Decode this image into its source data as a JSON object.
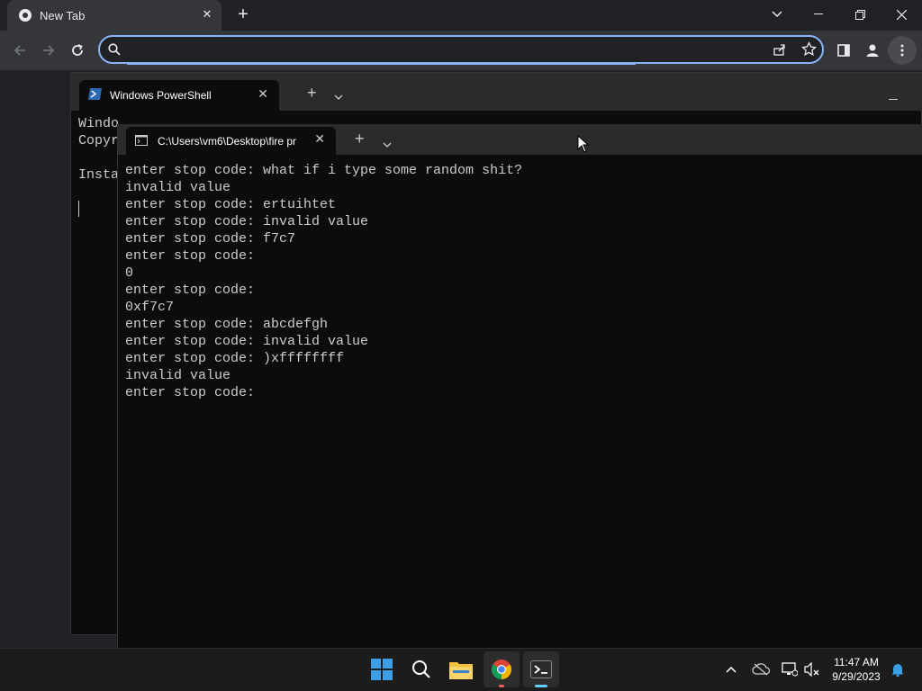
{
  "chrome": {
    "tab_title": "New Tab",
    "omnibox_value": "",
    "colors": {
      "accent": "#8ab4f8",
      "frame": "#202124",
      "toolbar": "#35363a"
    }
  },
  "powershell": {
    "tab_title": "Windows PowerShell",
    "visible_lines": [
      "Windo",
      "Copyr",
      "",
      "Insta"
    ]
  },
  "terminal": {
    "tab_title": "C:\\Users\\vm6\\Desktop\\fire pr",
    "lines": [
      "enter stop code: what if i type some random shit?",
      "invalid value",
      "enter stop code: ertuihtet",
      "enter stop code: invalid value",
      "enter stop code: f7c7",
      "enter stop code:",
      "0",
      "enter stop code:",
      "0xf7c7",
      "enter stop code: abcdefgh",
      "enter stop code: invalid value",
      "enter stop code: )xffffffff",
      "invalid value",
      "enter stop code:"
    ]
  },
  "taskbar": {
    "apps": [
      "windows-start",
      "search",
      "file-explorer",
      "chrome",
      "terminal"
    ],
    "clock_time": "11:47 AM",
    "clock_date": "9/29/2023"
  }
}
